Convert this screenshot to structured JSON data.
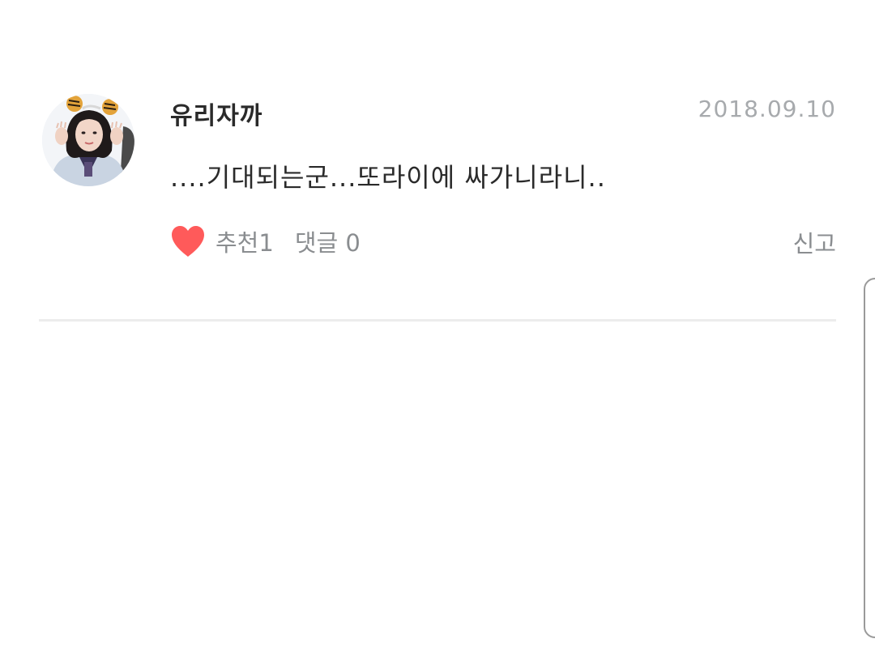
{
  "comment": {
    "username": "유리자까",
    "date": "2018.09.10",
    "text": "....기대되는군...또라이에 싸가니라니..",
    "like_label": "추천1",
    "reply_label": "댓글 0",
    "report_label": "신고"
  },
  "icons": {
    "like": "heart-icon",
    "avatar": "profile-avatar"
  },
  "colors": {
    "heart": "#ff5a5a",
    "secondary_text": "#8a8d90",
    "date_text": "#a7aaad",
    "primary_text": "#2a2a2a",
    "divider": "#ececec"
  }
}
